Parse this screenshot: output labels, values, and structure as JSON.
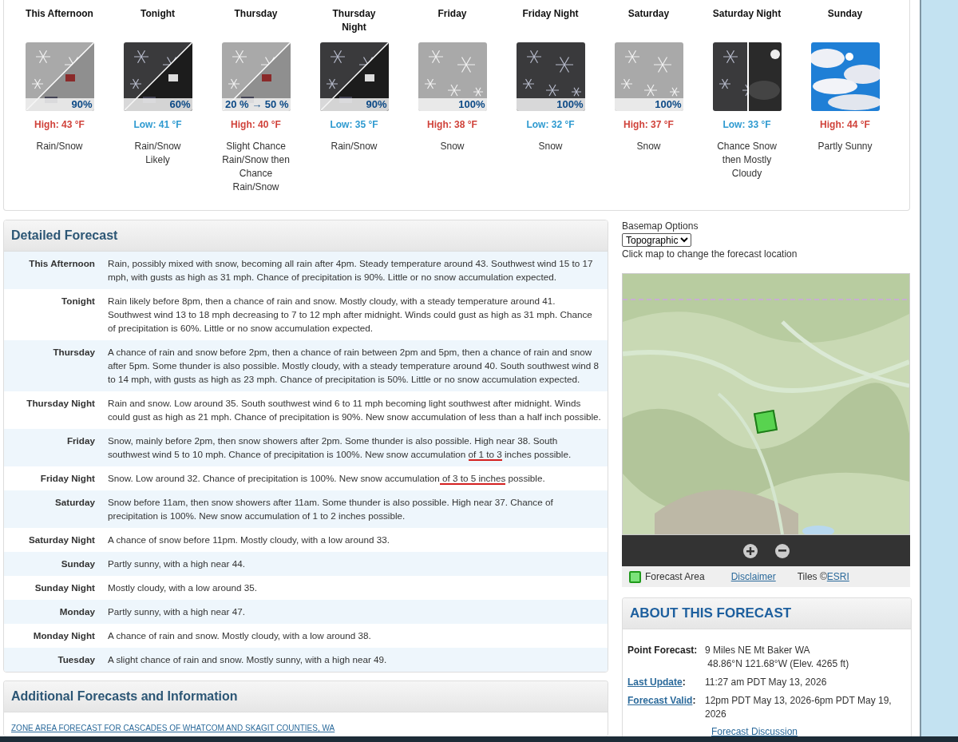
{
  "periods": [
    {
      "name": "This Afternoon",
      "image": {
        "kind": "split",
        "night": false
      },
      "pop": "90%",
      "temp": {
        "kind": "high",
        "text": "High: 43 °F"
      },
      "summary": "Rain/Snow"
    },
    {
      "name": "Tonight",
      "image": {
        "kind": "split",
        "night": true
      },
      "pop": "60%",
      "temp": {
        "kind": "low",
        "text": "Low: 41 °F"
      },
      "summary": "Rain/Snow Likely"
    },
    {
      "name": "Thursday",
      "image": {
        "kind": "split",
        "night": false
      },
      "pop": "20 % → 50 %",
      "temp": {
        "kind": "high",
        "text": "High: 40 °F"
      },
      "summary": "Slight Chance Rain/Snow then Chance Rain/Snow"
    },
    {
      "name": "Thursday\nNight",
      "image": {
        "kind": "split",
        "night": true
      },
      "pop": "90%",
      "temp": {
        "kind": "low",
        "text": "Low: 35 °F"
      },
      "summary": "Rain/Snow"
    },
    {
      "name": "Friday",
      "image": {
        "kind": "full",
        "night": false
      },
      "pop": "100%",
      "temp": {
        "kind": "high",
        "text": "High: 38 °F"
      },
      "summary": "Snow"
    },
    {
      "name": "Friday Night",
      "image": {
        "kind": "full",
        "night": true
      },
      "pop": "100%",
      "temp": {
        "kind": "low",
        "text": "Low: 32 °F"
      },
      "summary": "Snow"
    },
    {
      "name": "Saturday",
      "image": {
        "kind": "full",
        "night": false
      },
      "pop": "100%",
      "temp": {
        "kind": "high",
        "text": "High: 37 °F"
      },
      "summary": "Snow"
    },
    {
      "name": "Saturday Night",
      "image": {
        "kind": "half"
      },
      "temp": {
        "kind": "low",
        "text": "Low: 33 °F"
      },
      "summary": "Chance Snow then Mostly Cloudy"
    },
    {
      "name": "Sunday",
      "image": {
        "kind": "sunny"
      },
      "temp": {
        "kind": "high",
        "text": "High: 44 °F"
      },
      "summary": "Partly Sunny"
    }
  ],
  "detailed_forecast": {
    "title": "Detailed Forecast",
    "rows": [
      {
        "period": "This Afternoon",
        "segments": [
          {
            "text": "Rain, possibly mixed with snow, becoming all rain after 4pm. Steady temperature around 43. Southwest wind 15 to 17 mph, with gusts as high as 31 mph. Chance of precipitation is 90%. Little or no snow accumulation expected.",
            "underlined": false
          }
        ]
      },
      {
        "period": "Tonight",
        "segments": [
          {
            "text": "Rain likely before 8pm, then a chance of rain and snow. Mostly cloudy, with a steady temperature around 41. Southwest wind 13 to 18 mph decreasing to 7 to 12 mph after midnight. Winds could gust as high as 31 mph. Chance of precipitation is 60%. Little or no snow accumulation expected.",
            "underlined": false
          }
        ]
      },
      {
        "period": "Thursday",
        "segments": [
          {
            "text": "A chance of rain and snow before 2pm, then a chance of rain between 2pm and 5pm, then a chance of rain and snow after 5pm. Some thunder is also possible. Mostly cloudy, with a steady temperature around 40. South southwest wind 8 to 14 mph, with gusts as high as 23 mph. Chance of precipitation is 50%. Little or no snow accumulation expected.",
            "underlined": false
          }
        ]
      },
      {
        "period": "Thursday Night",
        "segments": [
          {
            "text": "Rain and snow. Low around 35. South southwest wind 6 to 11 mph becoming light southwest after midnight. Winds could gust as high as 21 mph. Chance of precipitation is 90%. New snow accumulation of less than a half inch possible.",
            "underlined": false
          }
        ]
      },
      {
        "period": "Friday",
        "segments": [
          {
            "text": "Snow, mainly before 2pm, then snow showers after 2pm. Some thunder is also possible. High near 38. South southwest wind 5 to 10 mph. Chance of precipitation is 100%. New snow accumulation ",
            "underlined": false
          },
          {
            "text": "of 1 to 3",
            "underlined": true
          },
          {
            "text": " inches possible.",
            "underlined": false
          }
        ]
      },
      {
        "period": "Friday Night",
        "segments": [
          {
            "text": "Snow. Low around 32. Chance of precipitation is 100%. New snow accumulation",
            "underlined": false
          },
          {
            "text": " of 3 to 5 inches",
            "underlined": true
          },
          {
            "text": " possible.",
            "underlined": false
          }
        ]
      },
      {
        "period": "Saturday",
        "segments": [
          {
            "text": "Snow before 11am, then snow showers after 11am. Some thunder is also possible. High near 37. Chance of precipitation is 100%. New snow accumulation of 1 to 2 inches possible.",
            "underlined": false
          }
        ]
      },
      {
        "period": "Saturday Night",
        "segments": [
          {
            "text": "A chance of snow before 11pm. Mostly cloudy, with a low around 33.",
            "underlined": false
          }
        ]
      },
      {
        "period": "Sunday",
        "segments": [
          {
            "text": "Partly sunny, with a high near 44.",
            "underlined": false
          }
        ]
      },
      {
        "period": "Sunday Night",
        "segments": [
          {
            "text": "Mostly cloudy, with a low around 35.",
            "underlined": false
          }
        ]
      },
      {
        "period": "Monday",
        "segments": [
          {
            "text": "Partly sunny, with a high near 47.",
            "underlined": false
          }
        ]
      },
      {
        "period": "Monday Night",
        "segments": [
          {
            "text": "A chance of rain and snow. Mostly cloudy, with a low around 38.",
            "underlined": false
          }
        ]
      },
      {
        "period": "Tuesday",
        "segments": [
          {
            "text": "A slight chance of rain and snow. Mostly sunny, with a high near 49.",
            "underlined": false
          }
        ]
      }
    ]
  },
  "additional": {
    "title": "Additional Forecasts and Information",
    "link": "ZONE AREA FORECAST FOR CASCADES OF WHATCOM AND SKAGIT COUNTIES, WA"
  },
  "map": {
    "basemap_label": "Basemap Options",
    "basemap_value": "Topographic",
    "hint": "Click map to change the forecast location",
    "legend": {
      "area": "Forecast Area",
      "disclaimer": "Disclaimer",
      "tiles": "Tiles ©",
      "tiles_link": "ESRI"
    }
  },
  "about": {
    "title": "ABOUT THIS FORECAST",
    "rows": [
      {
        "label": "Point Forecast:",
        "kind": "text",
        "lines": [
          "9 Miles NE Mt Baker WA",
          " 48.86°N 121.68°W (Elev. 4265 ft)"
        ]
      },
      {
        "label": "Last Update",
        "kind": "link",
        "suffix": ":",
        "lines": [
          "11:27 am PDT May 13, 2026"
        ]
      },
      {
        "label": "Forecast Valid",
        "kind": "link",
        "suffix": ":",
        "lines": [
          "12pm PDT May 13, 2026-6pm PDT May 19, 2026"
        ]
      }
    ],
    "discussion": "Forecast Discussion"
  }
}
